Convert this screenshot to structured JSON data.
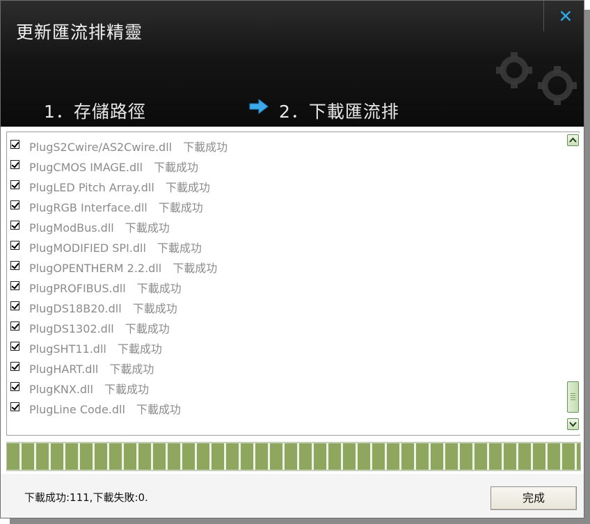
{
  "window": {
    "title": "更新匯流排精靈",
    "close_label": "✕"
  },
  "steps": {
    "step1": "1．存儲路徑",
    "step2": "2．下載匯流排"
  },
  "list": {
    "items": [
      {
        "file": "PlugS2Cwire/AS2Cwire.dll",
        "status": "下載成功",
        "checked": true
      },
      {
        "file": "PlugCMOS IMAGE.dll",
        "status": "下載成功",
        "checked": true
      },
      {
        "file": "PlugLED Pitch Array.dll",
        "status": "下載成功",
        "checked": true
      },
      {
        "file": "PlugRGB Interface.dll",
        "status": "下載成功",
        "checked": true
      },
      {
        "file": "PlugModBus.dll",
        "status": "下載成功",
        "checked": true
      },
      {
        "file": "PlugMODIFIED SPI.dll",
        "status": "下載成功",
        "checked": true
      },
      {
        "file": "PlugOPENTHERM 2.2.dll",
        "status": "下載成功",
        "checked": true
      },
      {
        "file": "PlugPROFIBUS.dll",
        "status": "下載成功",
        "checked": true
      },
      {
        "file": "PlugDS18B20.dll",
        "status": "下載成功",
        "checked": true
      },
      {
        "file": "PlugDS1302.dll",
        "status": "下載成功",
        "checked": true
      },
      {
        "file": "PlugSHT11.dll",
        "status": "下載成功",
        "checked": true
      },
      {
        "file": "PlugHART.dll",
        "status": "下載成功",
        "checked": true
      },
      {
        "file": "PlugKNX.dll",
        "status": "下載成功",
        "checked": true
      },
      {
        "file": "PlugLine Code.dll",
        "status": "下載成功",
        "checked": true
      }
    ]
  },
  "progress": {
    "percent": 100
  },
  "footer": {
    "summary": "下載成功:111,下載失敗:0.",
    "done_label": "完成"
  },
  "colors": {
    "header_bg": "#141414",
    "accent_blue": "#2fa8e6",
    "progress_green": "#8fa65f",
    "item_text": "#8b8b8b"
  },
  "icons": [
    "close-icon",
    "gears-icon",
    "arrow-right-icon",
    "checkbox-checked-icon",
    "scroll-up-icon",
    "scroll-down-icon"
  ]
}
